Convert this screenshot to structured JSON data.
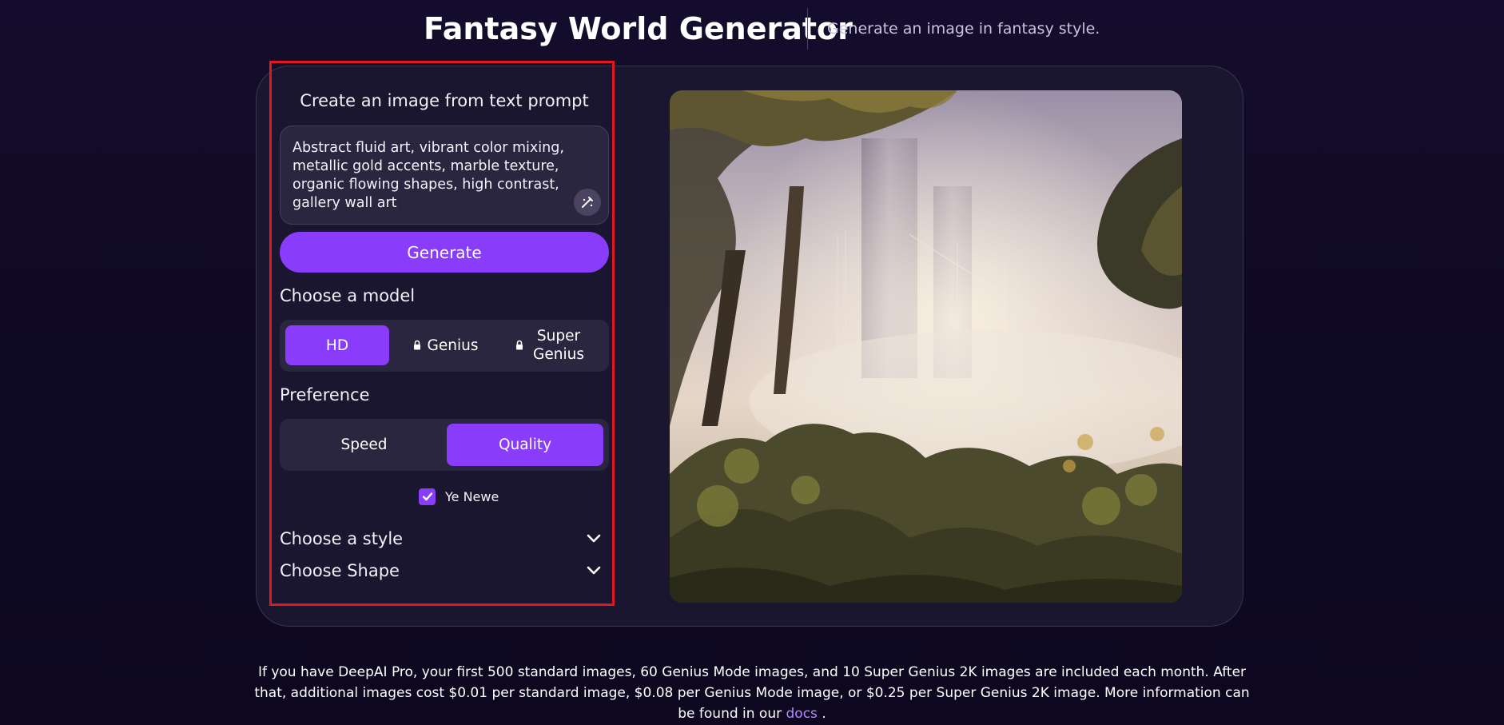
{
  "header": {
    "title": "Fantasy World Generator",
    "subtitle": "Generate an image in fantasy style."
  },
  "panel": {
    "heading": "Create an image from text prompt",
    "prompt_text": "Abstract fluid art, vibrant color mixing, metallic gold accents, marble texture, organic flowing shapes, high contrast, gallery wall art",
    "prompt_action_icon": "magic-wand-icon",
    "generate_label": "Generate",
    "model_label": "Choose a model",
    "models": [
      {
        "label": "HD",
        "selected": true,
        "locked": false
      },
      {
        "label": "Genius",
        "selected": false,
        "locked": true
      },
      {
        "label": "Super Genius",
        "selected": false,
        "locked": true
      }
    ],
    "preference_label": "Preference",
    "preferences": [
      {
        "label": "Speed",
        "selected": false
      },
      {
        "label": "Quality",
        "selected": true
      }
    ],
    "checkbox_label": "Ye Newe",
    "checkbox_checked": true,
    "style_label": "Choose a style",
    "shape_label": "Choose Shape"
  },
  "image": {
    "description": "Misty fantasy forest scene with tall ruined tower"
  },
  "footer": {
    "text": "If you have DeepAI Pro, your first 500 standard images, 60 Genius Mode images, and 10 Super Genius 2K images are included each month. After that, additional images cost $0.01 per standard image, $0.08 per Genius Mode image, or $0.25 per Super Genius 2K image. More information can be found in our",
    "link_text": "docs",
    "end": "."
  },
  "colors": {
    "accent": "#8a3cfb",
    "highlight": "#e0191d",
    "background": "#140c2c",
    "card": "#1b1630"
  }
}
